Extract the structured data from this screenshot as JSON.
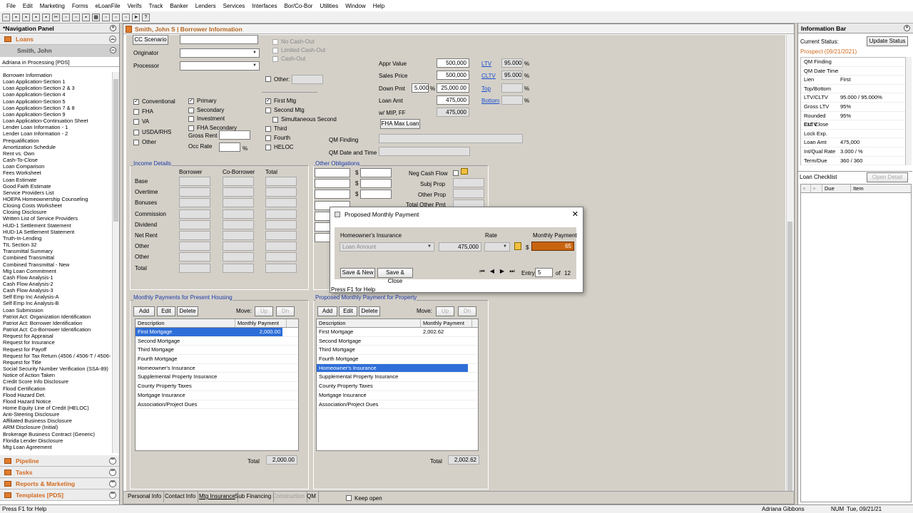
{
  "menu": [
    "File",
    "Edit",
    "Marketing",
    "Forms",
    "eLoanFile",
    "Verifs",
    "Track",
    "Banker",
    "Lenders",
    "Services",
    "Interfaces",
    "Bor/Co-Bor",
    "Utilities",
    "Window",
    "Help"
  ],
  "nav": {
    "title": "*Navigation Panel",
    "loans": "Loans",
    "borrower": "Smith, John",
    "status": "Adriana in Processing [PDS]",
    "items": [
      "Borrower Information",
      "Loan Application-Section 1",
      "Loan Application-Section 2 & 3",
      "Loan Application-Section 4",
      "Loan Application-Section 5",
      "Loan Application-Section 7 & 8",
      "Loan Application-Section 9",
      "Loan Application-Continuation Sheet",
      "Lender Loan Information - 1",
      "Lender Loan Information - 2",
      "Prequalification",
      "Amortization Schedule",
      "Rent vs. Own",
      "Cash-To-Close",
      "Loan Comparison",
      "Fees Worksheet",
      "Loan Estimate",
      "Good Faith Estimate",
      "Service Providers List",
      "HOEPA Homeownership Counseling",
      "Closing Costs Worksheet",
      "Closing Disclosure",
      "Written List of Service Providers",
      "HUD-1 Settlement Statement",
      "HUD-1A Settlement Statement",
      "Truth-In-Lending",
      "TIL Section 32",
      "Transmittal Summary",
      "Combined Transmittal",
      "Combined Transmittal - New",
      "Mtg Loan Commitment",
      "Cash Flow Analysis-1",
      "Cash Flow Analysis-2",
      "Cash Flow Analysis-3",
      "Self Emp Inc Analysis-A",
      "Self Emp Inc Analysis-B",
      "Loan Submission",
      "Patriot Act: Organization Identification",
      "Patriot Act: Borrower Identification",
      "Patriot Act: Co-Borrower Identification",
      "Request for Appraisal",
      "Request for Insurance",
      "Request for Payoff",
      "Request for Tax Return (4506 / 4506-T / 4506-",
      "Request for Title",
      "Social Security Number Verification (SSA-89)",
      "Notice of Action Taken",
      "Credit Score Info Disclosure",
      "Flood Certification",
      "Flood Hazard Det.",
      "Flood Hazard Notice",
      "Home Equity Line of Credit (HELOC)",
      "Anti-Steering Disclosure",
      "Affiliated Business Disclosure",
      "ARM Disclosure (Initial)",
      "Brokerage Business Contract (Generic)",
      "Florida Lender Disclosure",
      "Mtg Loan Agreement"
    ],
    "bottom": [
      "Pipeline",
      "Tasks",
      "Reports & Marketing",
      "Templates [PDS]"
    ]
  },
  "doc": {
    "title": "Smith, John S | Borrower Information",
    "cc_scenario": "CC Scenario",
    "originator": "Originator",
    "processor": "Processor",
    "loan_types": [
      "Conventional",
      "FHA",
      "VA",
      "USDA/RHS",
      "Other"
    ],
    "occupancy": [
      "Primary",
      "Secondary",
      "Investment",
      "FHA Secondary"
    ],
    "gross_rent": "Gross Rent",
    "occ_rate": "Occ Rate",
    "pct": "%",
    "top_checks": [
      "No Cash-Out",
      "Limited Cash-Out",
      "Cash-Out"
    ],
    "other": "Other:",
    "liens": [
      "First Mtg",
      "Second Mtg",
      "Simultaneous Second",
      "Third",
      "Fourth",
      "HELOC"
    ],
    "qm_finding": "QM Finding",
    "qm_date": "QM Date and Time",
    "appr_value_lbl": "Appr Value",
    "appr_value": "500,000",
    "sales_price_lbl": "Sales Price",
    "sales_price": "500,000",
    "down_pmt_lbl": "Down Pmt",
    "down_pct": "5.000",
    "down_amt": "25,000.00",
    "loan_amt_lbl": "Loan Amt",
    "loan_amt": "475,000",
    "mip_lbl": "w/ MIP, FF",
    "mip": "475,000",
    "fha_btn": "FHA Max Loan",
    "ltv": "LTV",
    "ltv_val": "95.000",
    "cltv": "CLTV",
    "cltv_val": "95.000",
    "top": "Top",
    "bottom": "Bottom",
    "income_title": "Income Details",
    "income_cols": [
      "Borrower",
      "Co-Borrower",
      "Total"
    ],
    "income_rows": [
      "Base",
      "Overtime",
      "Bonuses",
      "Commission",
      "Dividend",
      "Net Rent",
      "Other",
      "Other",
      "Total"
    ],
    "oblig_title": "Other Obligations",
    "neg_cash": "Neg Cash Flow",
    "subj_prop": "Subj Prop",
    "other_prop": "Other Prop",
    "total_other": "Total Other Pmt",
    "dollar": "$",
    "present_title": "Monthly Payments for Present Housing",
    "proposed_title": "Proposed Monthly Payment for Property",
    "add": "Add",
    "edit": "Edit",
    "delete": "Delete",
    "move": "Move:",
    "up": "Up",
    "dn": "Dn",
    "col_desc": "Description",
    "col_pay": "Monthly Payment",
    "present_rows": [
      [
        "First Mortgage",
        "2,000.00"
      ],
      [
        "Second Mortgage",
        ""
      ],
      [
        "Third Mortgage",
        ""
      ],
      [
        "Fourth Mortgage",
        ""
      ],
      [
        "Homeowner's Insurance",
        ""
      ],
      [
        "Supplemental Property Insurance",
        ""
      ],
      [
        "County Property Taxes",
        ""
      ],
      [
        "Mortgage Insurance",
        ""
      ],
      [
        "Association/Project Dues",
        ""
      ]
    ],
    "proposed_rows": [
      [
        "First Mortgage",
        "2,002.62"
      ],
      [
        "Second Mortgage",
        ""
      ],
      [
        "Third Mortgage",
        ""
      ],
      [
        "Fourth Mortgage",
        ""
      ],
      [
        "Homeowner's Insurance",
        ""
      ],
      [
        "Supplemental Property Insurance",
        ""
      ],
      [
        "County Property Taxes",
        ""
      ],
      [
        "Mortgage Insurance",
        ""
      ],
      [
        "Association/Project Dues",
        ""
      ]
    ],
    "total": "Total",
    "present_total": "2,000.00",
    "proposed_total": "2,002.62",
    "tabs": [
      "Personal Info",
      "Contact Info",
      "Mtg Insurance",
      "Sub Financing",
      "Construction",
      "QM"
    ],
    "keep_open": "Keep open"
  },
  "dialog": {
    "title": "Proposed Monthly Payment",
    "item": "Homeowner's Insurance",
    "rate": "Rate",
    "monthly": "Monthly Payment",
    "basis": "Loan Amount",
    "amount": "475,000",
    "dollar": "$",
    "value": "65",
    "save_new": "Save & New",
    "save_close": "Save & Close",
    "entry": "Entry",
    "entry_val": "5",
    "of": "of",
    "count": "12",
    "help": "Press F1 for Help"
  },
  "info": {
    "title": "Information Bar",
    "current_status": "Current Status:",
    "update": "Update Status",
    "status": "Prospect (09/21/2021)",
    "rows": [
      [
        "QM Finding",
        ""
      ],
      [
        "QM Date Time",
        ""
      ],
      [
        "Lien",
        "First"
      ],
      [
        "Top/Bottom",
        ""
      ],
      [
        "LTV/CLTV",
        "95.000 / 95.000%"
      ],
      [
        "Gross LTV",
        "95%"
      ],
      [
        "Rounded CLTV",
        "95%"
      ],
      [
        "Est. Close",
        ""
      ],
      [
        "Lock Exp.",
        ""
      ],
      [
        "Loan Amt",
        "475,000"
      ],
      [
        "Int/Qual Rate",
        "3.000 / %"
      ],
      [
        "Term/Due",
        "360 / 360"
      ]
    ],
    "checklist": "Loan Checklist",
    "open_detail": "Open Detail",
    "due": "Due",
    "item": "Item"
  },
  "statusbar": {
    "help": "Press F1 for Help",
    "user": "Adriana Gibbons",
    "num": "NUM",
    "date": "Tue, 09/21/21"
  }
}
